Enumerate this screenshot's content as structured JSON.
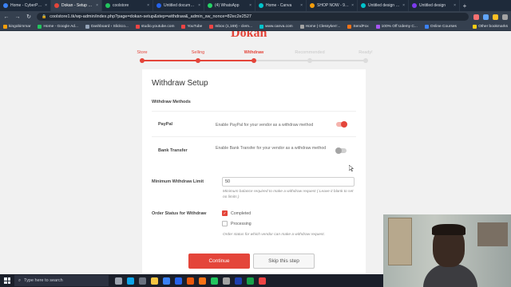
{
  "browser": {
    "tabs": [
      {
        "title": "Home - CyberPanel",
        "favicon_color": "#3b82f6",
        "active": false
      },
      {
        "title": "Dokan - Setup Wi...",
        "favicon_color": "#e4453a",
        "active": true
      },
      {
        "title": "coolstore",
        "favicon_color": "#22c55e",
        "active": false
      },
      {
        "title": "Untitled documen...",
        "favicon_color": "#2563eb",
        "active": false
      },
      {
        "title": "(4) WhatsApp",
        "favicon_color": "#25d366",
        "active": false
      },
      {
        "title": "Home - Canva",
        "favicon_color": "#00c4cc",
        "active": false
      },
      {
        "title": "SHOP NOW - 930...",
        "favicon_color": "#f59e0b",
        "active": false
      },
      {
        "title": "Untitled design -...",
        "favicon_color": "#00c4cc",
        "active": false
      },
      {
        "title": "Untitled design",
        "favicon_color": "#7c3aed",
        "active": false
      }
    ],
    "url": "coolstore1.tk/wp-admin/index.php?page=dokan-setup&step=withdraw&_admin_sw_nonce=82ec2e2527",
    "bookmarks": [
      {
        "label": "kingobimmar",
        "color": "#f59e0b"
      },
      {
        "label": "Home - Google Ad...",
        "color": "#22c55e"
      },
      {
        "label": "Dashboard ‹ Slickco...",
        "color": "#94a3b8"
      },
      {
        "label": "studio.youtube.com",
        "color": "#ef4444"
      },
      {
        "label": "YouTube",
        "color": "#ef4444"
      },
      {
        "label": "Inbox (1,169) - clem...",
        "color": "#ef4444"
      },
      {
        "label": "www.canva.com",
        "color": "#00c4cc"
      },
      {
        "label": "Home | Clessyken'...",
        "color": "#a3a3a3"
      },
      {
        "label": "SendFox",
        "color": "#f97316"
      },
      {
        "label": "100% Off Udemy C...",
        "color": "#a855f7"
      },
      {
        "label": "Online Courses",
        "color": "#3b82f6"
      }
    ],
    "other_bookmarks": "Other bookmarks"
  },
  "page": {
    "logo_text": "okan",
    "steps": [
      {
        "label": "Store",
        "state": "done"
      },
      {
        "label": "Selling",
        "state": "done"
      },
      {
        "label": "Withdraw",
        "state": "current"
      },
      {
        "label": "Recommended",
        "state": "todo"
      },
      {
        "label": "Ready!",
        "state": "todo"
      }
    ],
    "title": "Withdraw Setup",
    "methods_title": "Withdraw Methods",
    "methods": [
      {
        "name": "PayPal",
        "description": "Enable PayPal for your vendor as a withdraw method",
        "enabled": true
      },
      {
        "name": "Bank Transfer",
        "description": "Enable Bank Transfer for your vendor as a withdraw method",
        "enabled": false
      }
    ],
    "limit": {
      "label": "Minimum Withdraw Limit",
      "value": "50",
      "help": "Minimum balance required to make a withdraw request ( Leave it blank to set no limits )"
    },
    "order_status": {
      "label": "Order Status for Withdraw",
      "options": [
        {
          "label": "Completed",
          "checked": true
        },
        {
          "label": "Processing",
          "checked": false
        }
      ],
      "help": "Order status for which vendor can make a withdraw request."
    },
    "continue_label": "Continue",
    "skip_label": "Skip this step"
  },
  "taskbar": {
    "search_placeholder": "Type here to search",
    "icons": [
      {
        "name": "task-view-icon",
        "color": "#9ca3af"
      },
      {
        "name": "edge-icon",
        "color": "#0ea5e9"
      },
      {
        "name": "settings-icon",
        "color": "#6b7280"
      },
      {
        "name": "file-explorer-icon",
        "color": "#f5c542"
      },
      {
        "name": "store-icon",
        "color": "#3b82f6"
      },
      {
        "name": "mail-icon",
        "color": "#2563eb"
      },
      {
        "name": "office-icon",
        "color": "#ea580c"
      },
      {
        "name": "firefox-icon",
        "color": "#f97316"
      },
      {
        "name": "chrome-icon",
        "color": "#22c55e"
      },
      {
        "name": "app-icon",
        "color": "#a3a3a3"
      },
      {
        "name": "photoshop-icon",
        "color": "#1e40af"
      },
      {
        "name": "camtasia-icon",
        "color": "#16a34a"
      },
      {
        "name": "chrome-active-icon",
        "color": "#ef4444"
      }
    ]
  },
  "colors": {
    "accent": "#e4453a"
  }
}
